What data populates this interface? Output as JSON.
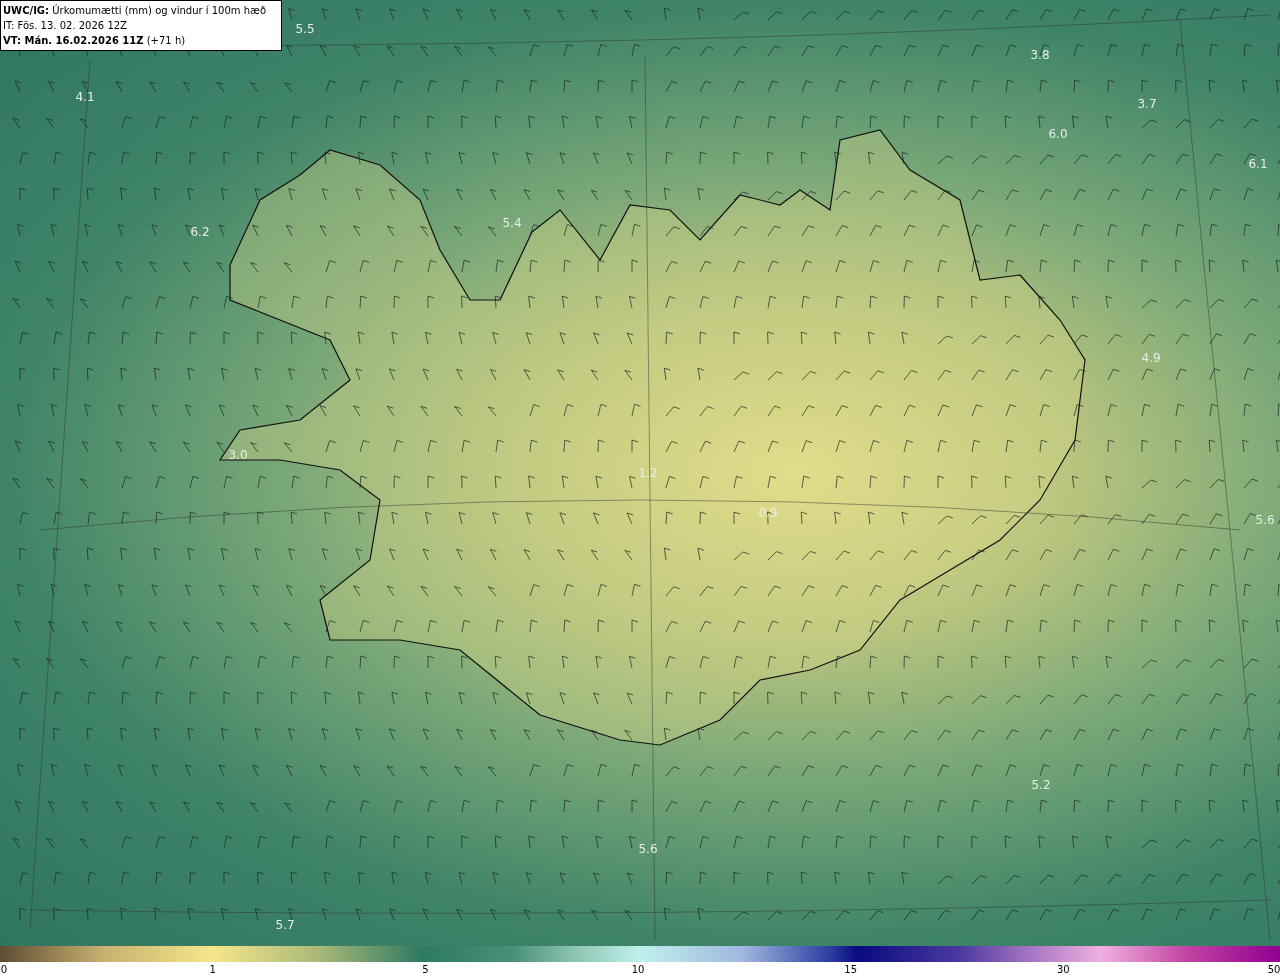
{
  "header": {
    "lines": [
      "**UWC/IG:** Úrkomumætti (mm) og vindur í 100m hæð",
      "IT: Fös. 13. 02. 2026 12Z",
      "**VT: Mán. 16.02.2026 11Z** (+71 h)"
    ]
  },
  "map_labels": [
    "5.5",
    "4.1",
    "3.8",
    "3.7",
    "6.0",
    "6.1",
    "6.2",
    "5.4",
    "4.9",
    "3.0",
    "1.2",
    "0.9",
    "5.6",
    "5.2",
    "5.6",
    "5.7"
  ],
  "colorbar": {
    "ticks": [
      "0",
      "1",
      "5",
      "10",
      "15",
      "30",
      "50"
    ]
  }
}
